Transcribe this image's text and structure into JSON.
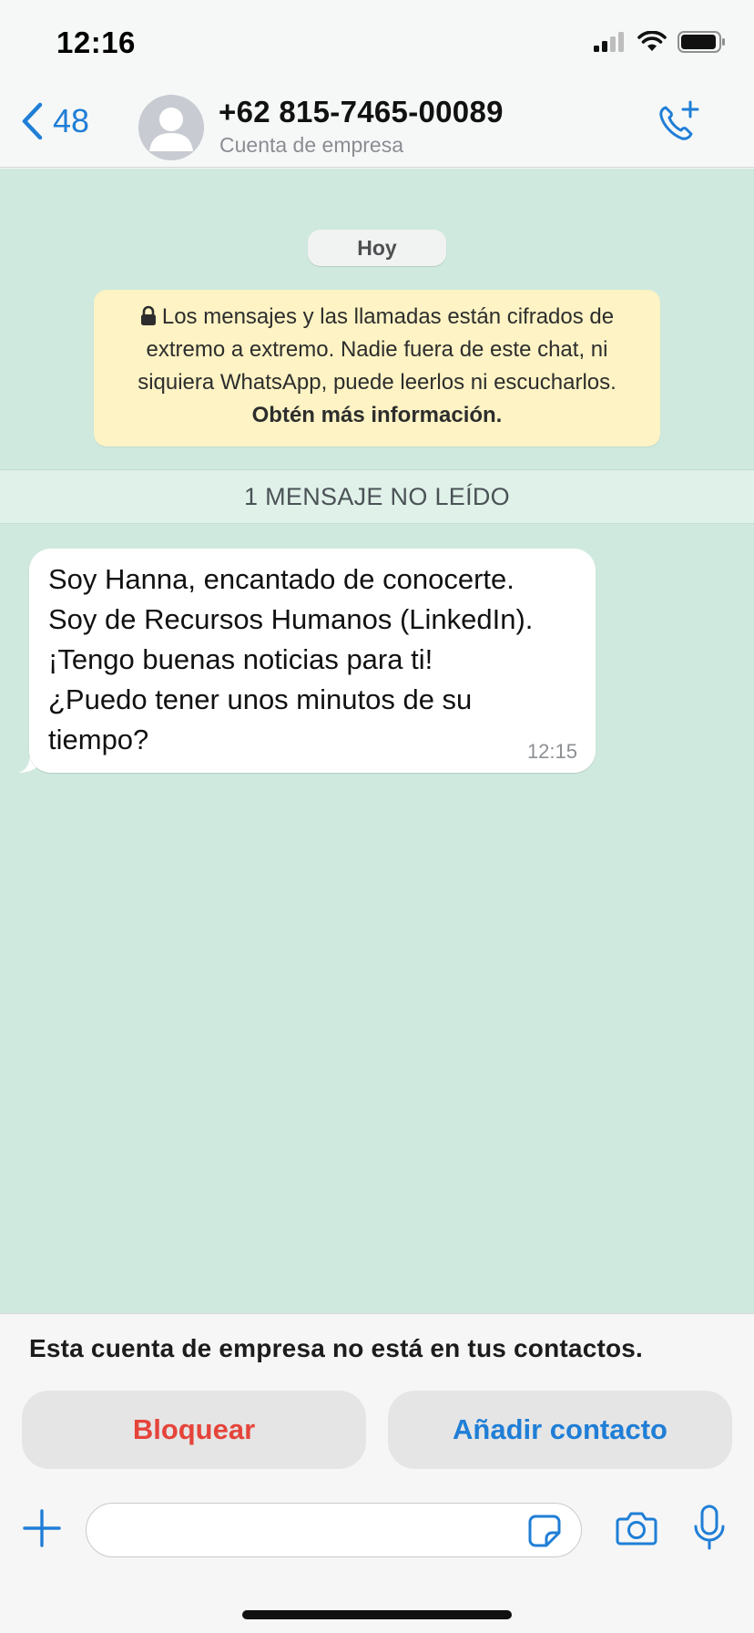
{
  "status_bar": {
    "time": "12:16"
  },
  "header": {
    "back_count": "48",
    "contact_name": "+62 815-7465-00089",
    "contact_subtitle": "Cuenta de empresa"
  },
  "chat": {
    "day_label": "Hoy",
    "encryption_notice": {
      "text": "Los mensajes y las llamadas están cifrados de extremo a extremo. Nadie fuera de este chat, ni siquiera WhatsApp, puede leerlos ni escucharlos.",
      "link": "Obtén más información."
    },
    "unread_label": "1 MENSAJE NO LEÍDO",
    "messages": [
      {
        "text": "Soy Hanna, encantado de conocerte.\nSoy de Recursos Humanos (LinkedIn).\n¡Tengo buenas noticias para ti!\n¿Puedo tener unos minutos de su\ntiempo?",
        "time": "12:15"
      }
    ]
  },
  "business_panel": {
    "notice": "Esta cuenta de empresa no está en tus contactos.",
    "block_label": "Bloquear",
    "add_label": "Añadir contacto"
  },
  "composer": {
    "placeholder": ""
  },
  "colors": {
    "accent": "#1f7ed6",
    "danger": "#e5443b",
    "chat_bg": "#cfe9de",
    "notice_bg": "#fdf3c4"
  }
}
